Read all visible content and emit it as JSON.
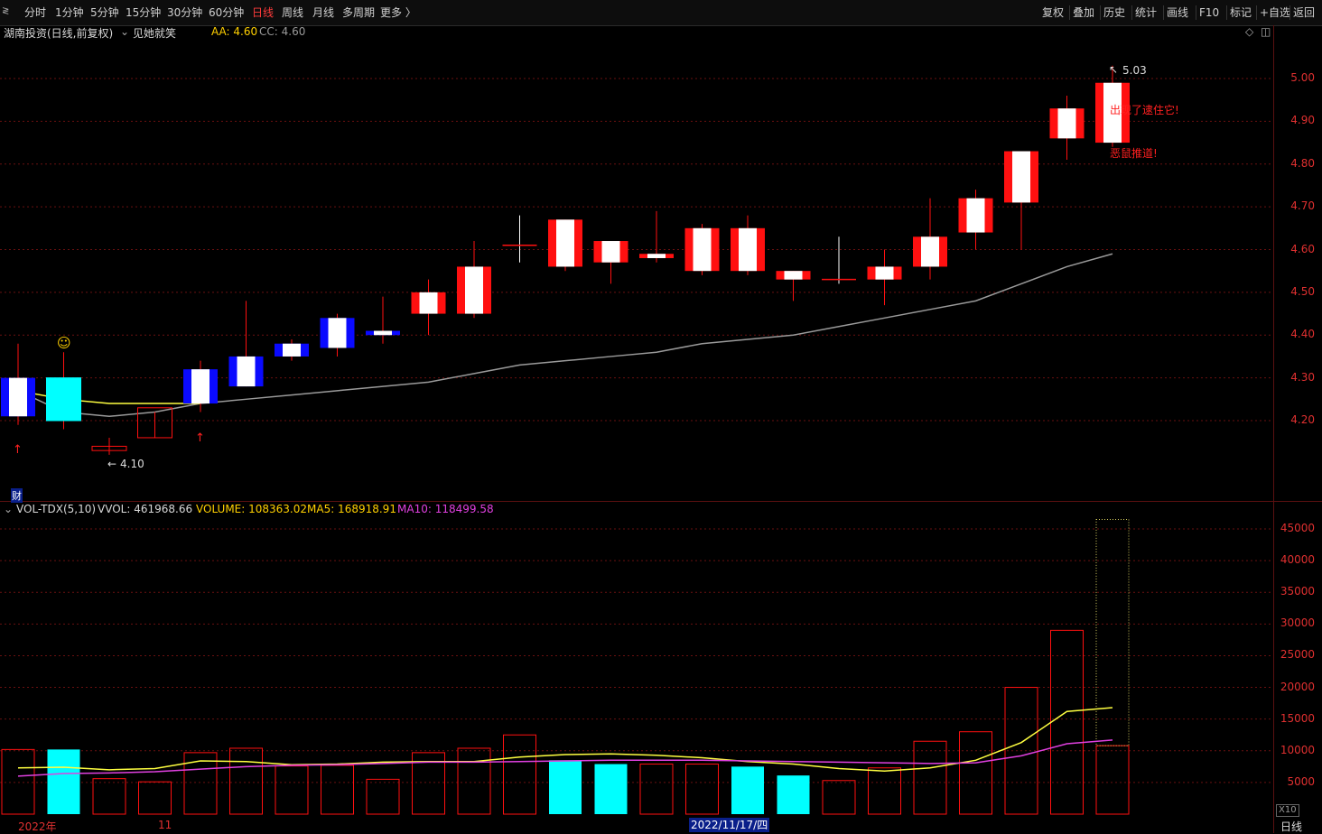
{
  "toolbar": {
    "left": [
      {
        "label": "分时",
        "active": false
      },
      {
        "label": "1分钟",
        "active": false
      },
      {
        "label": "5分钟",
        "active": false
      },
      {
        "label": "15分钟",
        "active": false
      },
      {
        "label": "30分钟",
        "active": false
      },
      {
        "label": "60分钟",
        "active": false
      },
      {
        "label": "日线",
        "active": true
      },
      {
        "label": "周线",
        "active": false
      },
      {
        "label": "月线",
        "active": false
      },
      {
        "label": "多周期",
        "active": false
      },
      {
        "label": "更多 〉",
        "active": false
      }
    ],
    "right": [
      "复权",
      "叠加",
      "历史",
      "统计",
      "画线",
      "F10",
      "标记",
      "+自选",
      "返回"
    ]
  },
  "info": {
    "stock_title": "湖南投资(日线,前复权)",
    "indicator_name": "见她就笑",
    "aa": "AA: 4.60",
    "cc": "CC: 4.60"
  },
  "volume_info": {
    "name": "VOL-TDX(5,10)",
    "vvol": "VVOL: 461968.66",
    "volume": "VOLUME: 108363.02",
    "ma5": "MA5: 168918.91",
    "ma10": "MA10: 118499.58"
  },
  "colors": {
    "up": "#ff1010",
    "down_blue": "#0a0aff",
    "down_cyan": "#00ffff",
    "ma_gray": "#9a9a9a",
    "ma_yellow": "#ffff40",
    "ma_magenta": "#e040e0",
    "grid": "#6a1010",
    "axis_text": "#e03030"
  },
  "annotations": {
    "high_label": "5.03",
    "low_label": "4.10",
    "note1": "出现了逮住它!",
    "note2": "恶鼠推道!",
    "cai_badge": "财"
  },
  "bottom_axis": {
    "year_label": "2022年",
    "month_label": "11",
    "date_highlight": "2022/11/17/四",
    "period": "日线",
    "x10": "X10"
  },
  "chart_data": [
    {
      "type": "candlestick",
      "title": "湖南投资(日线,前复权)",
      "y_ticks": [
        5.0,
        4.9,
        4.8,
        4.7,
        4.6,
        4.5,
        4.4,
        4.3,
        4.2
      ],
      "ylim": [
        4.05,
        5.08
      ],
      "candles": [
        {
          "o": 4.3,
          "h": 4.38,
          "l": 4.19,
          "c": 4.21,
          "color": "blue"
        },
        {
          "o": 4.3,
          "h": 4.36,
          "l": 4.18,
          "c": 4.2,
          "color": "cyan"
        },
        {
          "o": 4.14,
          "h": 4.16,
          "l": 4.12,
          "c": 4.13,
          "color": "hollow"
        },
        {
          "o": 4.16,
          "h": 4.22,
          "l": 4.16,
          "c": 4.23,
          "color": "hollow"
        },
        {
          "o": 4.32,
          "h": 4.34,
          "l": 4.22,
          "c": 4.24,
          "color": "blue"
        },
        {
          "o": 4.35,
          "h": 4.48,
          "l": 4.28,
          "c": 4.28,
          "color": "blue"
        },
        {
          "o": 4.38,
          "h": 4.39,
          "l": 4.34,
          "c": 4.35,
          "color": "blue"
        },
        {
          "o": 4.44,
          "h": 4.45,
          "l": 4.35,
          "c": 4.37,
          "color": "blue"
        },
        {
          "o": 4.41,
          "h": 4.49,
          "l": 4.38,
          "c": 4.4,
          "color": "blue"
        },
        {
          "o": 4.45,
          "h": 4.53,
          "l": 4.4,
          "c": 4.5,
          "color": "red"
        },
        {
          "o": 4.45,
          "h": 4.62,
          "l": 4.44,
          "c": 4.56,
          "color": "red"
        },
        {
          "o": 4.61,
          "h": 4.68,
          "l": 4.57,
          "c": 4.61,
          "color": "cross"
        },
        {
          "o": 4.56,
          "h": 4.67,
          "l": 4.55,
          "c": 4.67,
          "color": "red"
        },
        {
          "o": 4.62,
          "h": 4.62,
          "l": 4.52,
          "c": 4.57,
          "color": "red"
        },
        {
          "o": 4.58,
          "h": 4.69,
          "l": 4.57,
          "c": 4.59,
          "color": "red"
        },
        {
          "o": 4.55,
          "h": 4.66,
          "l": 4.54,
          "c": 4.65,
          "color": "red"
        },
        {
          "o": 4.55,
          "h": 4.68,
          "l": 4.54,
          "c": 4.65,
          "color": "red"
        },
        {
          "o": 4.53,
          "h": 4.55,
          "l": 4.48,
          "c": 4.55,
          "color": "red"
        },
        {
          "o": 4.53,
          "h": 4.63,
          "l": 4.52,
          "c": 4.53,
          "color": "cross"
        },
        {
          "o": 4.53,
          "h": 4.6,
          "l": 4.47,
          "c": 4.56,
          "color": "red"
        },
        {
          "o": 4.56,
          "h": 4.72,
          "l": 4.53,
          "c": 4.63,
          "color": "red"
        },
        {
          "o": 4.64,
          "h": 4.74,
          "l": 4.6,
          "c": 4.72,
          "color": "red"
        },
        {
          "o": 4.71,
          "h": 4.83,
          "l": 4.6,
          "c": 4.83,
          "color": "red"
        },
        {
          "o": 4.86,
          "h": 4.96,
          "l": 4.81,
          "c": 4.93,
          "color": "red"
        },
        {
          "o": 4.85,
          "h": 5.03,
          "l": 4.84,
          "c": 4.99,
          "color": "red"
        }
      ],
      "ma_gray": [
        4.27,
        4.22,
        4.21,
        4.22,
        4.24,
        4.25,
        4.26,
        4.27,
        4.28,
        4.29,
        4.31,
        4.33,
        4.34,
        4.35,
        4.36,
        4.38,
        4.39,
        4.4,
        4.42,
        4.44,
        4.46,
        4.48,
        4.52,
        4.56,
        4.59
      ],
      "ma_yellow": [
        4.27,
        4.25,
        4.24,
        4.24,
        4.24
      ]
    },
    {
      "type": "bar",
      "title": "VOL-TDX(5,10)",
      "y_ticks": [
        45000,
        40000,
        35000,
        30000,
        25000,
        20000,
        15000,
        10000,
        5000
      ],
      "ylim": [
        0,
        48000
      ],
      "values": [
        10200,
        10200,
        5600,
        5100,
        9700,
        10400,
        7600,
        7700,
        5500,
        9700,
        10400,
        12500,
        8500,
        7900,
        7900,
        7900,
        7500,
        6100,
        5300,
        7300,
        11500,
        13000,
        20000,
        29000,
        10800
      ],
      "colors": [
        "hollow",
        "cyan",
        "hollow",
        "hollow",
        "hollow",
        "hollow",
        "hollow",
        "hollow",
        "hollow",
        "hollow",
        "hollow",
        "hollow",
        "cyan",
        "cyan",
        "hollow",
        "hollow",
        "cyan",
        "cyan",
        "hollow",
        "hollow",
        "hollow",
        "hollow",
        "hollow",
        "hollow",
        "hollow"
      ],
      "ma5": [
        7300,
        7400,
        7000,
        7200,
        8400,
        8300,
        7800,
        7900,
        8200,
        8300,
        8300,
        9000,
        9400,
        9500,
        9300,
        8900,
        8300,
        7900,
        7200,
        6800,
        7300,
        8500,
        11300,
        16200,
        16800
      ],
      "ma10": [
        6000,
        6400,
        6500,
        6700,
        7100,
        7500,
        7700,
        7800,
        8000,
        8200,
        8200,
        8300,
        8400,
        8500,
        8500,
        8500,
        8400,
        8300,
        8200,
        8100,
        8000,
        8100,
        9200,
        11100,
        11700
      ],
      "highlight_bar_max": 46500
    }
  ]
}
